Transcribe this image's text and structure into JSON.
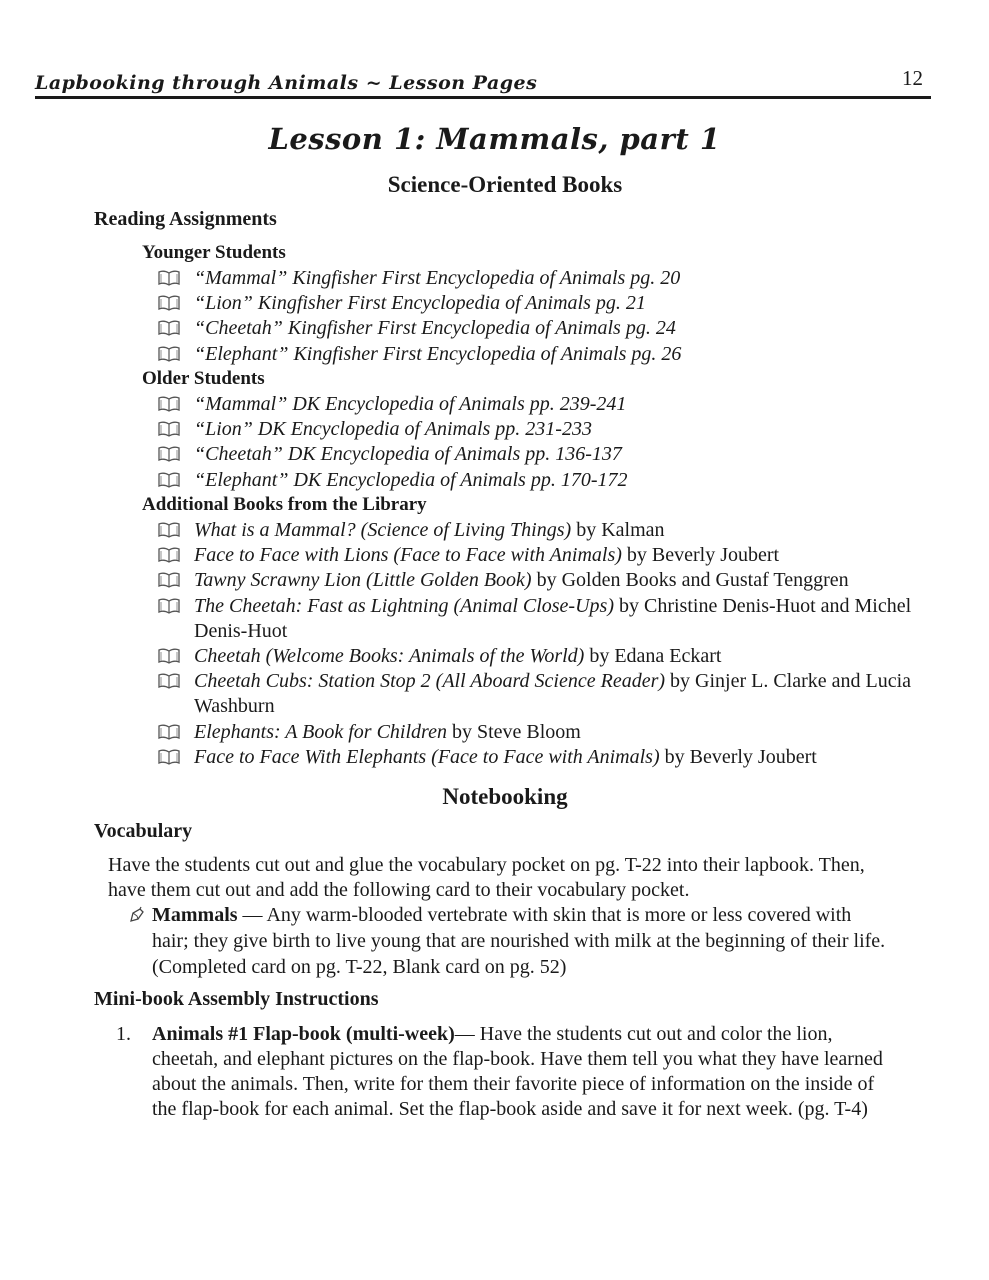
{
  "header": {
    "title": "Lapbooking through Animals ~ Lesson Pages",
    "page_number": "12"
  },
  "lesson_title": "Lesson 1: Mammals, part 1",
  "science_section": {
    "heading": "Science-Oriented Books",
    "reading_assignments": {
      "heading": "Reading Assignments",
      "younger": {
        "heading": "Younger Students",
        "items": [
          {
            "icon": "book-icon",
            "italic": "“Mammal” Kingfisher First Encyclopedia of Animals pg. 20",
            "normal": ""
          },
          {
            "icon": "book-icon",
            "italic": "“Lion” Kingfisher First Encyclopedia of Animals pg. 21",
            "normal": ""
          },
          {
            "icon": "book-icon",
            "italic": "“Cheetah” Kingfisher First Encyclopedia of Animals pg. 24",
            "normal": ""
          },
          {
            "icon": "book-icon",
            "italic": "“Elephant” Kingfisher First Encyclopedia of Animals pg. 26",
            "normal": ""
          }
        ]
      },
      "older": {
        "heading": "Older Students",
        "items": [
          {
            "icon": "book-icon",
            "italic": "“Mammal” DK Encyclopedia of Animals pp. 239-241",
            "normal": ""
          },
          {
            "icon": "book-icon",
            "italic": "“Lion” DK Encyclopedia of Animals pp. 231-233",
            "normal": ""
          },
          {
            "icon": "book-icon",
            "italic": "“Cheetah” DK Encyclopedia of Animals pp. 136-137",
            "normal": ""
          },
          {
            "icon": "book-icon",
            "italic": "“Elephant” DK Encyclopedia of Animals pp. 170-172",
            "normal": ""
          }
        ]
      },
      "library": {
        "heading": "Additional Books from the Library",
        "items": [
          {
            "icon": "book-icon",
            "italic": "What is a Mammal? (Science of Living Things)",
            "normal": " by Kalman"
          },
          {
            "icon": "book-icon",
            "italic": "Face to Face with Lions (Face to Face with Animals)",
            "normal": " by Beverly Joubert"
          },
          {
            "icon": "book-icon",
            "italic": "Tawny Scrawny Lion (Little Golden Book)",
            "normal": " by Golden Books and Gustaf Tenggren"
          },
          {
            "icon": "book-icon",
            "italic": "The Cheetah: Fast as Lightning (Animal Close-Ups)",
            "normal": " by Christine Denis-Huot and Michel Denis-Huot"
          },
          {
            "icon": "book-icon",
            "italic": "Cheetah (Welcome Books: Animals of the World)",
            "normal": " by Edana Eckart"
          },
          {
            "icon": "book-icon",
            "italic": "Cheetah Cubs: Station Stop 2 (All Aboard Science Reader)",
            "normal": " by Ginjer L. Clarke and Lucia Washburn"
          },
          {
            "icon": "book-icon",
            "italic": "Elephants: A Book for Children",
            "normal": " by Steve Bloom"
          },
          {
            "icon": "book-icon",
            "italic": "Face to Face With Elephants (Face to Face with Animals)",
            "normal": " by Beverly Joubert"
          }
        ]
      }
    }
  },
  "notebooking": {
    "heading": "Notebooking",
    "vocabulary": {
      "heading": "Vocabulary",
      "intro_line1": "Have the students cut out and glue the vocabulary pocket on pg. T-22 into their lapbook. Then,",
      "intro_line2": "have them cut out and add the following card to their vocabulary pocket.",
      "card": {
        "icon": "pencil-icon",
        "term": "Mammals",
        "definition_line1": " — Any warm-blooded vertebrate with skin that is more or less covered with",
        "definition_line2": "hair; they give birth to live young that are nourished with milk at the beginning of their life.",
        "definition_line3": "(Completed card on pg. T-22, Blank card on pg. 52)"
      }
    },
    "minibook": {
      "heading": "Mini-book Assembly Instructions",
      "items": [
        {
          "number": "1.",
          "title": "Animals #1 Flap-book (multi-week)",
          "line1": "— Have the students cut out and color the lion,",
          "line2": "cheetah, and elephant pictures on the flap-book.  Have them tell you what they have learned",
          "line3": "about the animals.  Then, write for them their favorite piece of information on the inside of",
          "line4": "the flap-book for each animal. Set the flap-book aside and save it for next week. (pg. T-4)"
        }
      ]
    }
  }
}
